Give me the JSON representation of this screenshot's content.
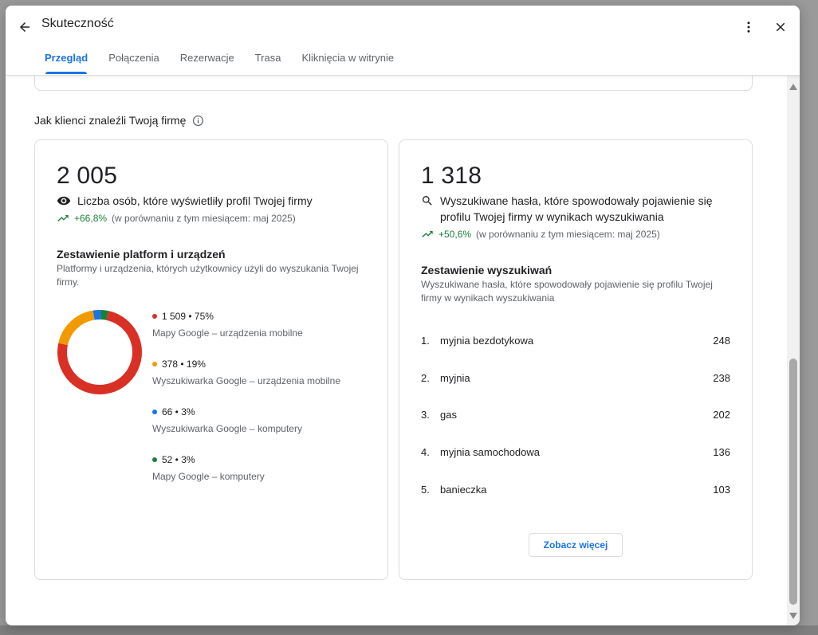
{
  "header": {
    "title": "Skuteczność"
  },
  "tabs": [
    {
      "label": "Przegląd",
      "active": true
    },
    {
      "label": "Połączenia",
      "active": false
    },
    {
      "label": "Rezerwacje",
      "active": false
    },
    {
      "label": "Trasa",
      "active": false
    },
    {
      "label": "Kliknięcia w witrynie",
      "active": false
    }
  ],
  "section": {
    "title": "Jak klienci znaleźli Twoją firmę"
  },
  "profile_views": {
    "total": "2 005",
    "label": "Liczba osób, które wyświetliły profil Twojej firmy",
    "change": "+66,8%",
    "comparison": "(w porównaniu z tym miesiącem: maj 2025)",
    "breakdown_title": "Zestawienie platform i urządzeń",
    "breakdown_desc": "Platformy i urządzenia, których użytkownicy użyli do wyszukania Twojej firmy.",
    "platforms": [
      {
        "value": "1 509 • 75%",
        "label": "Mapy Google – urządzenia mobilne",
        "color": "#d93025",
        "share": 75
      },
      {
        "value": "378 • 19%",
        "label": "Wyszukiwarka Google – urządzenia mobilne",
        "color": "#f29900",
        "share": 19
      },
      {
        "value": "66 • 3%",
        "label": "Wyszukiwarka Google – komputery",
        "color": "#1a73e8",
        "share": 3
      },
      {
        "value": "52 • 3%",
        "label": "Mapy Google – komputery",
        "color": "#188038",
        "share": 3
      }
    ]
  },
  "searches": {
    "total": "1 318",
    "label": "Wyszukiwane hasła, które spowodowały pojawienie się profilu Twojej firmy w wynikach wyszukiwania",
    "change": "+50,6%",
    "comparison": "(w porównaniu z tym miesiącem: maj 2025)",
    "breakdown_title": "Zestawienie wyszukiwań",
    "breakdown_desc": "Wyszukiwane hasła, które spowodowały pojawienie się profilu Twojej firmy w wynikach wyszukiwania",
    "terms": [
      {
        "rank": "1.",
        "term": "myjnia bezdotykowa",
        "count": "248"
      },
      {
        "rank": "2.",
        "term": "myjnia",
        "count": "238"
      },
      {
        "rank": "3.",
        "term": "gas",
        "count": "202"
      },
      {
        "rank": "4.",
        "term": "myjnia samochodowa",
        "count": "136"
      },
      {
        "rank": "5.",
        "term": "banieczka",
        "count": "103"
      }
    ],
    "more_label": "Zobacz więcej"
  },
  "colors": {
    "accent": "#1a73e8",
    "positive": "#188038"
  }
}
